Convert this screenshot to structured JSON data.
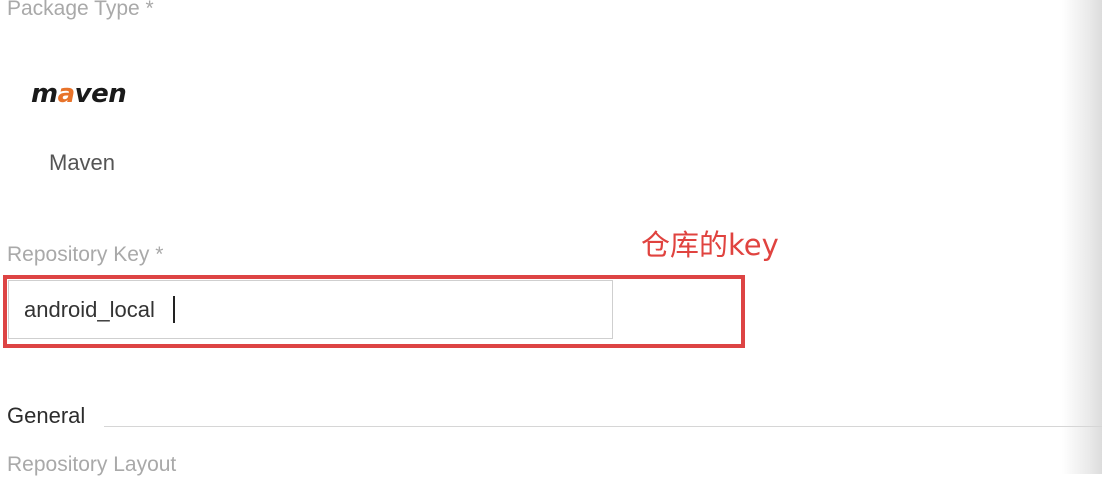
{
  "form": {
    "package_type_label": "Package Type *",
    "package": {
      "logo_prefix": "m",
      "logo_accent": "a",
      "logo_suffix": "ven",
      "name": "Maven",
      "accent_color": "#e8732a"
    },
    "repository_key_label": "Repository Key *",
    "repository_key_value": "android_local",
    "general_section_title": "General",
    "repository_layout_label": "Repository Layout"
  },
  "annotation": {
    "text": "仓库的key",
    "color": "#dd4444"
  }
}
